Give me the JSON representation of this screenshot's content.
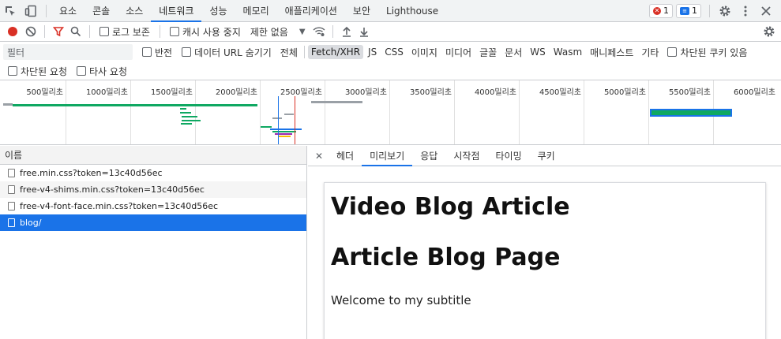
{
  "devtools": {
    "panel_tabs": [
      "요소",
      "콘솔",
      "소스",
      "네트워크",
      "성능",
      "메모리",
      "애플리케이션",
      "보안",
      "Lighthouse"
    ],
    "active_panel": "네트워크",
    "error_count": "1",
    "message_count": "1"
  },
  "toolbar": {
    "preserve_log": "로그 보존",
    "disable_cache": "캐시 사용 중지",
    "throttling": "제한 없음"
  },
  "filter": {
    "placeholder": "필터",
    "invert": "반전",
    "hide_data_urls": "데이터 URL 숨기기",
    "types": [
      "전체",
      "Fetch/XHR",
      "JS",
      "CSS",
      "이미지",
      "미디어",
      "글꼴",
      "문서",
      "WS",
      "Wasm",
      "매니페스트",
      "기타"
    ],
    "active_type": "Fetch/XHR",
    "blocked_cookies": "차단된 쿠키 있음",
    "blocked_requests": "차단된 요청",
    "third_party": "타사 요청"
  },
  "overview": {
    "ticks": [
      "500밀리초",
      "1000밀리초",
      "1500밀리초",
      "2000밀리초",
      "2500밀리초",
      "3000밀리초",
      "3500밀리초",
      "4000밀리초",
      "4500밀리초",
      "5000밀리초",
      "5500밀리초",
      "6000밀리초"
    ],
    "colors": {
      "green": "#0fa862",
      "blue": "#1a73e8",
      "gray": "#9aa0a6",
      "red": "#d93025",
      "purple": "#9c27b0"
    }
  },
  "requests": {
    "column_name": "이름",
    "items": [
      {
        "name": "free.min.css?token=13c40d56ec"
      },
      {
        "name": "free-v4-shims.min.css?token=13c40d56ec"
      },
      {
        "name": "free-v4-font-face.min.css?token=13c40d56ec"
      },
      {
        "name": "blog/"
      }
    ],
    "selected_index": 3
  },
  "detail": {
    "tabs": [
      "헤더",
      "미리보기",
      "응답",
      "시작점",
      "타이밍",
      "쿠키"
    ],
    "active_tab": "미리보기"
  },
  "preview": {
    "heading1": "Video Blog Article",
    "heading2": "Article Blog Page",
    "paragraph": "Welcome to my subtitle"
  }
}
